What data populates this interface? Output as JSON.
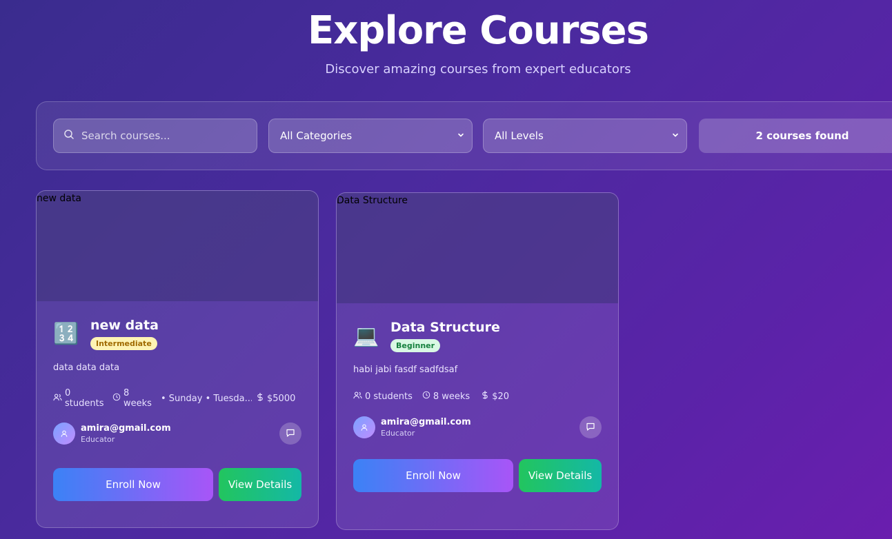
{
  "header": {
    "title": "Explore Courses",
    "subtitle": "Discover amazing courses from expert educators"
  },
  "filters": {
    "search_placeholder": "Search courses...",
    "category": "All Categories",
    "level": "All Levels",
    "count_label": "2 courses found"
  },
  "courses": [
    {
      "thumb_label": "new data",
      "emoji": "🔢",
      "title": "new data",
      "level": "Intermediate",
      "description": "data data data",
      "students": "0 students",
      "duration": "8 weeks",
      "schedule": "• Sunday • Tuesda...",
      "price": "$5000",
      "educator_email": "amira@gmail.com",
      "educator_role": "Educator",
      "enroll_label": "Enroll Now",
      "details_label": "View Details"
    },
    {
      "thumb_label": "Data Structure",
      "emoji": "💻",
      "title": "Data Structure",
      "level": "Beginner",
      "description": "habi jabi fasdf sadfdsaf",
      "students": "0 students",
      "duration": "8 weeks",
      "price": "$20",
      "educator_email": "amira@gmail.com",
      "educator_role": "Educator",
      "enroll_label": "Enroll Now",
      "details_label": "View Details"
    }
  ],
  "colors": {
    "intermediate_badge_bg": "#fdf3b4",
    "intermediate_badge_text": "#a06a00",
    "beginner_badge_bg": "#d9f8e4",
    "beginner_badge_text": "#15803d"
  },
  "icons": [
    "search-icon",
    "chevron-down-icon",
    "users-icon",
    "clock-icon",
    "dollar-icon",
    "user-icon",
    "message-icon"
  ]
}
